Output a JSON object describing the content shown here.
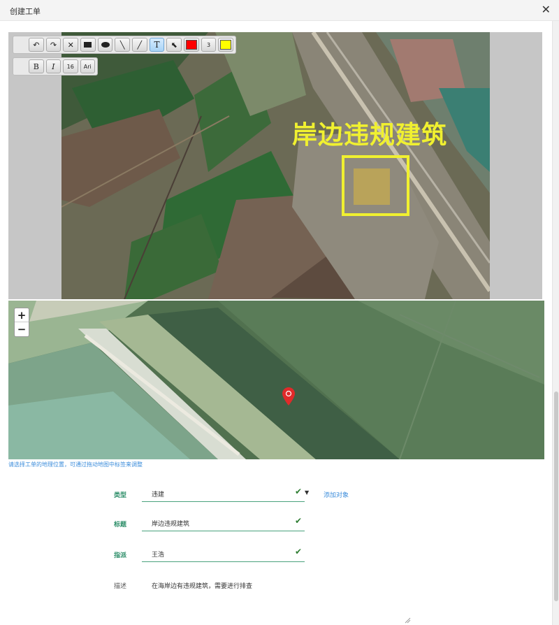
{
  "dialog": {
    "title": "创建工单",
    "close_symbol": "✕"
  },
  "toolbar": {
    "row1": [
      "undo-icon",
      "redo-icon",
      "delete-icon",
      "rectangle-icon",
      "ellipse-icon",
      "line-icon",
      "pen-icon",
      "text-icon",
      "arrow-icon",
      "stroke-color",
      "stroke-width",
      "fill-color"
    ],
    "line_width": "3",
    "stroke_color": "#ff0000",
    "fill_color": "#ffff00",
    "bold": "B",
    "italic": "I",
    "font_size": "16",
    "font_name": "Ari"
  },
  "annotation": {
    "text": "岸边违规建筑",
    "color": "#f0f030"
  },
  "map": {
    "zoom_in": "+",
    "zoom_out": "−",
    "hint": "请选择工单的地理位置，可通过拖动地图中标签来调整"
  },
  "form": {
    "type": {
      "label": "类型",
      "value": "违建",
      "add_link": "添加对象"
    },
    "title": {
      "label": "标题",
      "value": "岸边违规建筑"
    },
    "assign": {
      "label": "指派",
      "value": "王浩"
    },
    "desc": {
      "label": "描述",
      "value": "在海岸边有违规建筑，需要进行排查"
    }
  }
}
